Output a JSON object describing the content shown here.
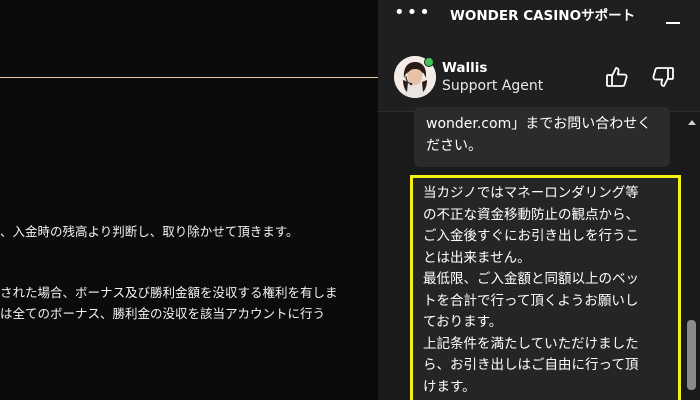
{
  "page": {
    "lines": [
      "、入金時の残高より判断し、取り除かせて頂きます。",
      "された場合、ボーナス及び勝利金額を没収する権利を有しま",
      "は全てのボーナス、勝利金の没収を該当アカウントに行う"
    ],
    "colors": {
      "background": "#0b0b0b",
      "divider": "#e8c9a8"
    }
  },
  "chat": {
    "title": "WONDER CASINOサポート",
    "menu_icon": "more-dots-icon",
    "minimize_icon": "minimize-icon",
    "agent": {
      "name": "Wallis",
      "role": "Support Agent",
      "status": "online",
      "status_color": "#43c15b"
    },
    "rating_icons": [
      "thumbs-up-icon",
      "thumbs-down-icon"
    ],
    "previous_message": {
      "lines": [
        "wonder.com」までお問い合わせく",
        "ださい。"
      ]
    },
    "highlighted_message": {
      "lines": [
        "当カジノではマネーロンダリング等",
        "の不正な資金移動防止の観点から、",
        "ご入金後すぐにお引き出しを行うこ",
        "とは出来ません。",
        "最低限、ご入金額と同額以上のベッ",
        "トを合計で行って頂くようお願いし",
        "ております。",
        "上記条件を満たしていただけました",
        "ら、お引き出しはご自由に行って頂",
        "けます。"
      ],
      "highlight_color": "#f5f10f"
    }
  }
}
